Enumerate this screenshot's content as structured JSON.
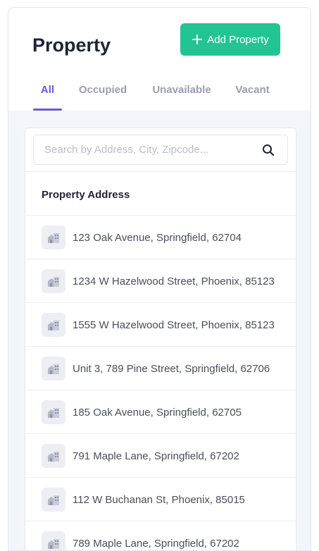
{
  "header": {
    "title": "Property",
    "add_button_label": "Add Property",
    "add_button_icon": "plus-icon",
    "accent_color": "#22c493"
  },
  "tabs": [
    {
      "label": "All",
      "active": true
    },
    {
      "label": "Occupied",
      "active": false
    },
    {
      "label": "Unavailable",
      "active": false
    },
    {
      "label": "Vacant",
      "active": false
    }
  ],
  "tab_active_color": "#6a5bd4",
  "search": {
    "placeholder": "Search by Address, City, Zipcode...",
    "value": "",
    "icon": "search-icon"
  },
  "table": {
    "column_header": "Property Address",
    "row_icon": "building-icon",
    "rows": [
      {
        "address": "123 Oak Avenue, Springfield, 62704"
      },
      {
        "address": "1234 W Hazelwood Street, Phoenix, 85123"
      },
      {
        "address": "1555 W Hazelwood Street, Phoenix, 85123"
      },
      {
        "address": "Unit 3, 789 Pine Street, Springfield, 62706"
      },
      {
        "address": "185 Oak Avenue, Springfield, 62705"
      },
      {
        "address": "791 Maple Lane, Springfield, 67202"
      },
      {
        "address": "112 W Buchanan St, Phoenix, 85015"
      },
      {
        "address": "789 Maple Lane, Springfield, 67202"
      }
    ]
  }
}
